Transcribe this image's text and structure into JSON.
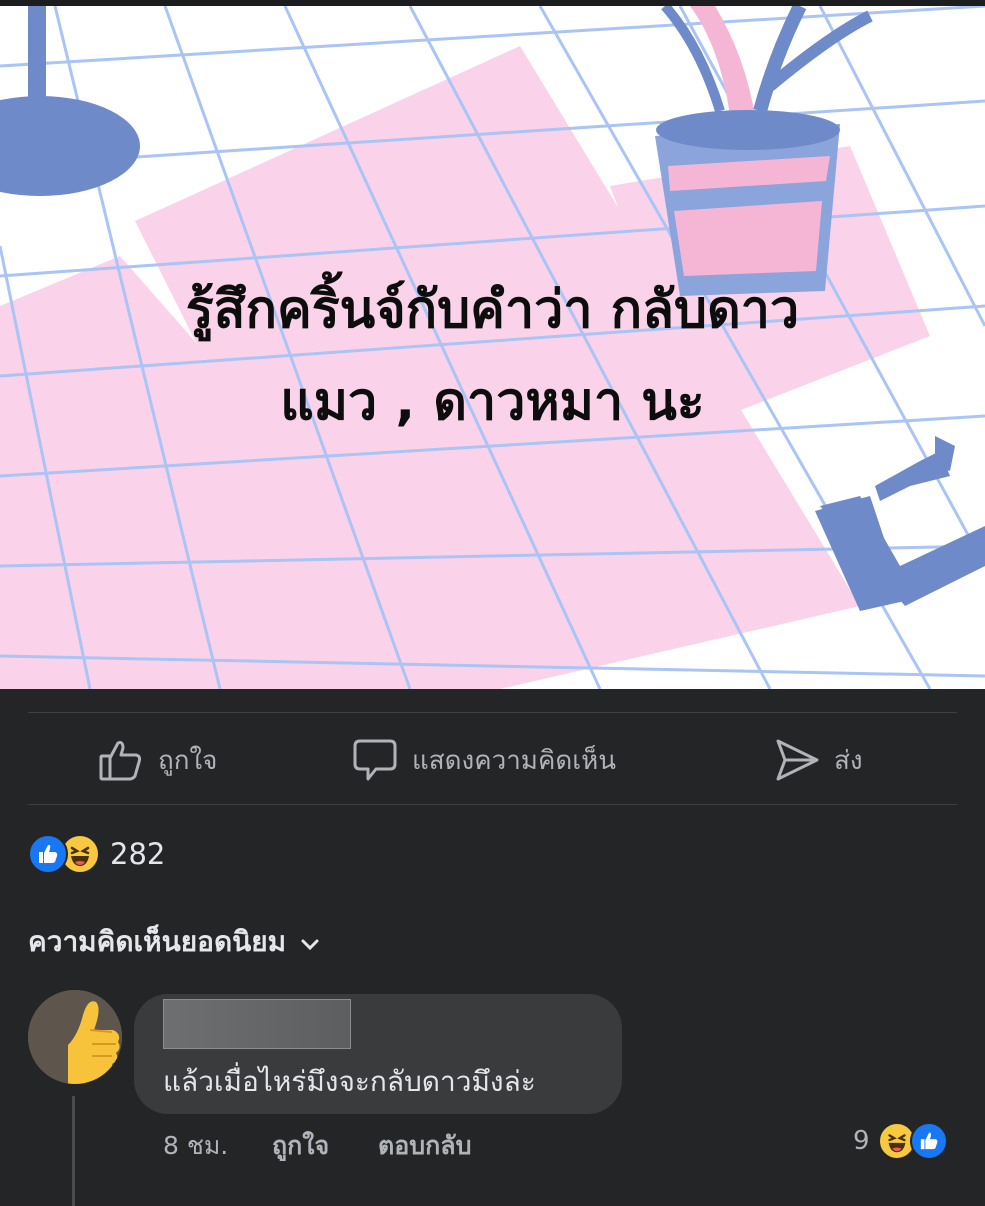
{
  "post": {
    "text_line1": "รู้สึกคริ้นจ์กับคำว่า กลับดาว",
    "text_line2": "แมว , ดาวหมา นะ"
  },
  "actions": {
    "like_label": "ถูกใจ",
    "comment_label": "แสดงความคิดเห็น",
    "share_label": "ส่ง"
  },
  "reactions": {
    "types": [
      "like",
      "haha"
    ],
    "count": "282"
  },
  "comments_sort": {
    "label": "ความคิดเห็นยอดนิยม"
  },
  "comment": {
    "text": "แล้วเมื่อไหร่มึงจะกลับดาวมึงล่ะ",
    "time": "8 ชม.",
    "like_label": "ถูกใจ",
    "reply_label": "ตอบกลับ",
    "reaction_count": "9",
    "reaction_types": [
      "haha",
      "like"
    ]
  },
  "colors": {
    "background": "#242526",
    "text_primary": "#e4e6eb",
    "text_secondary": "#b0b3b8",
    "like_blue": "#1877f2",
    "haha_yellow": "#f7c940",
    "grid_blue": "#a9c4f5",
    "pink": "#fad3ea",
    "illustration_blue": "#6f8ac9"
  }
}
